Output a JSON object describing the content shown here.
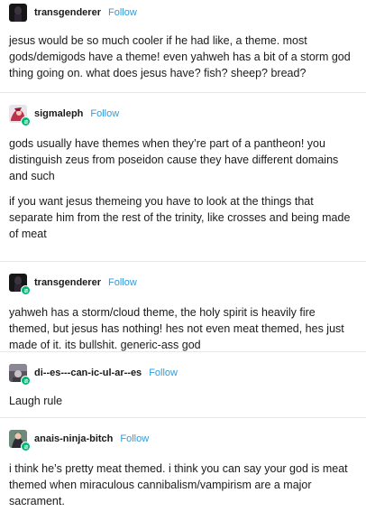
{
  "posts": [
    {
      "username": "transgenderer",
      "follow_label": "Follow",
      "paragraphs": [
        "jesus would be so much cooler if he had like, a theme. most gods/demigods have a theme! even yahweh has a bit of a storm god thing going on. what does jesus have? fish? sheep? bread?"
      ]
    },
    {
      "username": "sigmaleph",
      "follow_label": "Follow",
      "paragraphs": [
        "gods usually have themes when they’re part of a pantheon! you distinguish zeus from poseidon cause they have different domains and such",
        "if you want jesus themeing you have to look at the things that separate him from the rest of the trinity, like crosses and being made of meat"
      ]
    },
    {
      "username": "transgenderer",
      "follow_label": "Follow",
      "paragraphs": [
        "yahweh has a storm/cloud theme, the holy spirit is heavily fire themed, but jesus has nothing! hes not even meat themed, hes just made of it. its bullshit. generic-ass god"
      ]
    },
    {
      "username": "di--es---can-ic-ul-ar--es",
      "follow_label": "Follow",
      "paragraphs": [
        "Laugh rule"
      ]
    },
    {
      "username": "anais-ninja-bitch",
      "follow_label": "Follow",
      "paragraphs": [
        "i think he’s pretty meat themed. i think you can say your god is meat themed when miraculous cannibalism/vampirism are a major sacrament."
      ]
    }
  ],
  "colors": {
    "follow": "#2d9cdb",
    "badge": "#02b875",
    "divider": "#e8e8e8"
  }
}
